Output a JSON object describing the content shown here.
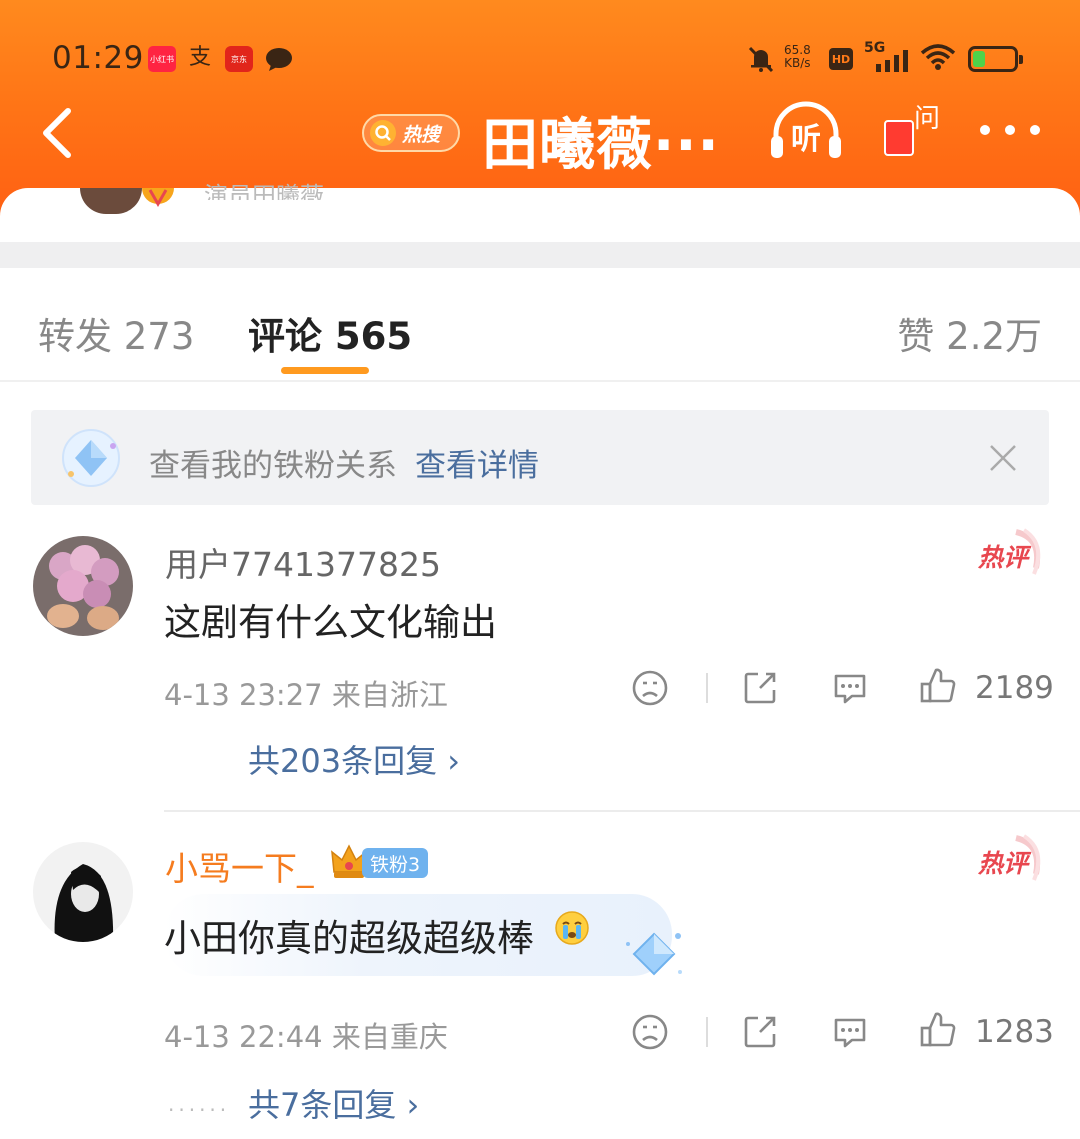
{
  "status_bar": {
    "time": "01:29",
    "xhs_label": "小红书",
    "zhi_label": "支",
    "jd_label": "京东",
    "speed_value": "65.8",
    "speed_unit": "KB/s",
    "hd_label": "HD",
    "network": "5G"
  },
  "nav": {
    "hot_label": "热搜",
    "title": "田曦薇···",
    "listen_label": "听",
    "ask_label": "问"
  },
  "post_peek": {
    "author_text": "演员田曦薇"
  },
  "tabs": {
    "repost": "转发 273",
    "comments": "评论 565",
    "likes": "赞 2.2万"
  },
  "fan_banner": {
    "text": "查看我的铁粉关系",
    "link": "查看详情"
  },
  "comments": [
    {
      "username": "用户7741377825",
      "text": "这剧有什么文化输出",
      "meta": "4-13 23:27 来自浙江",
      "likes": "2189",
      "replies": "共203条回复 ›",
      "tag": "热评"
    },
    {
      "username": "小骂一下_",
      "badge": "铁粉3",
      "text": "小田你真的超级超级棒",
      "meta": "4-13 22:44 来自重庆",
      "likes": "1283",
      "replies": "共7条回复 ›",
      "tag": "热评"
    }
  ],
  "colors": {
    "header_orange": "#ff7416",
    "tab_underline": "#ff9a1f",
    "link_blue": "#4a6e9e",
    "hot_red": "#e8474f",
    "vip_orange": "#f57c1f"
  },
  "icons": [
    "back-icon",
    "search-icon",
    "headphones-icon",
    "red-envelope-icon",
    "more-icon",
    "diamond-icon",
    "close-icon",
    "dislike-icon",
    "share-icon",
    "reply-icon",
    "like-icon",
    "crown-icon",
    "crying-emoji-icon"
  ]
}
